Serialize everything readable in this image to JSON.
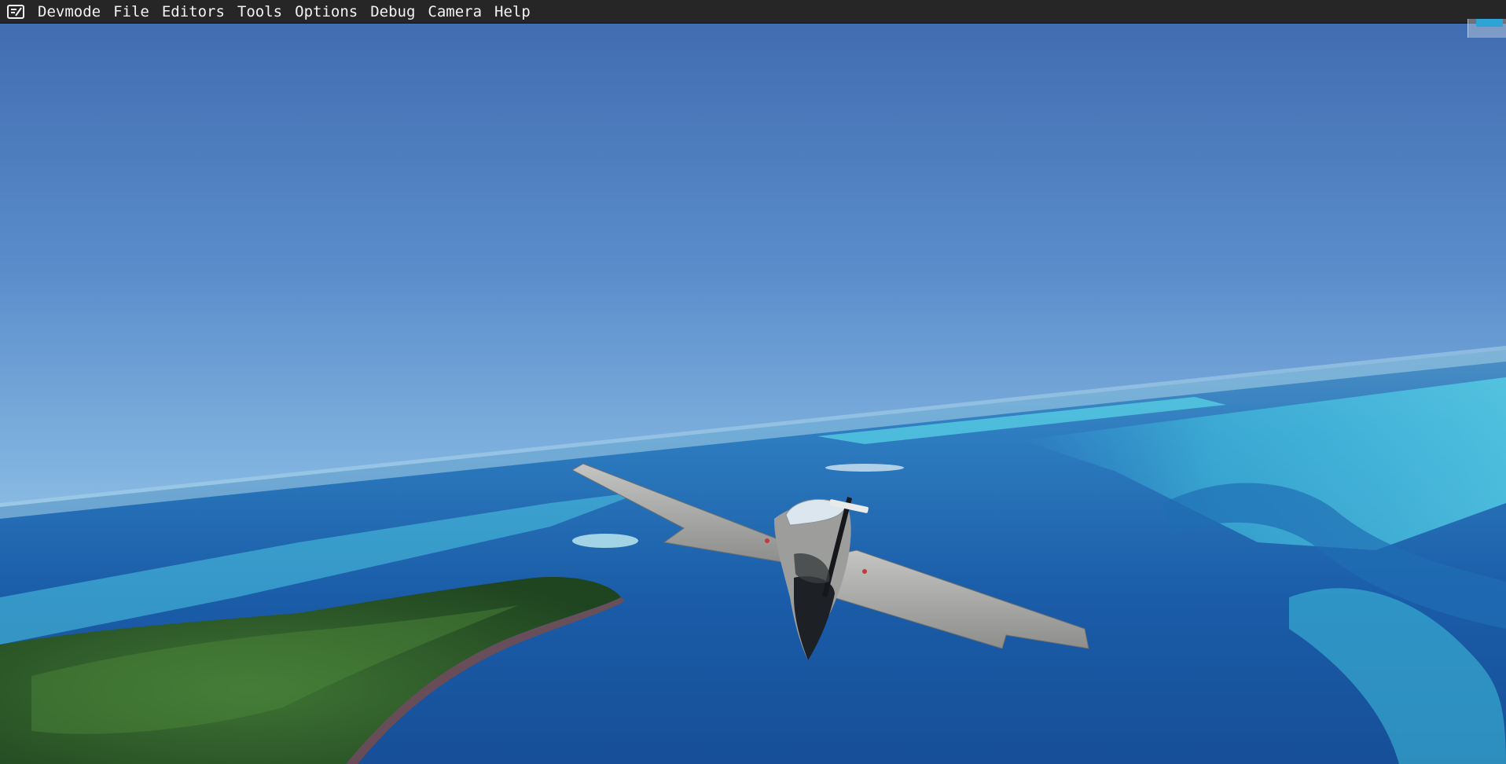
{
  "menubar": {
    "icon": "devmode-icon",
    "items": [
      {
        "label": "Devmode"
      },
      {
        "label": "File"
      },
      {
        "label": "Editors"
      },
      {
        "label": "Tools"
      },
      {
        "label": "Options"
      },
      {
        "label": "Debug"
      },
      {
        "label": "Camera"
      },
      {
        "label": "Help"
      }
    ]
  },
  "colors": {
    "menubar_bg": "#262626",
    "menubar_text": "#f2f2f2",
    "sky_top": "#3f6fb3",
    "sky_horizon": "#cfe7f2",
    "ocean_deep": "#1e5fa6",
    "reef_turquoise": "#3ec6e0",
    "island_green": "#2f5a2a",
    "aircraft_body": "#a9aaa8"
  }
}
